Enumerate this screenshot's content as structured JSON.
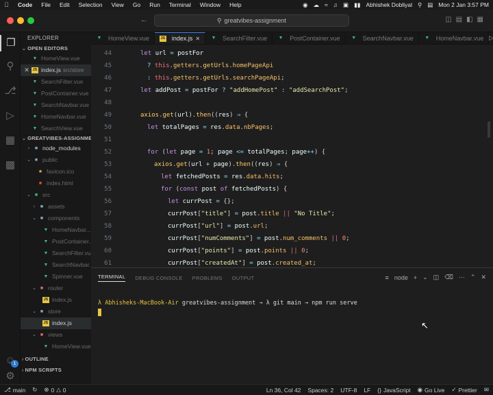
{
  "menubar": {
    "items": [
      "Code",
      "File",
      "Edit",
      "Selection",
      "View",
      "Go",
      "Run",
      "Terminal",
      "Window",
      "Help"
    ],
    "user": "Abhishek Dobliyal",
    "datetime": "Mon 2 Jan  3:57 PM"
  },
  "titlebar": {
    "search_text": "greatvibes-assignment"
  },
  "activity": {
    "badge": "1"
  },
  "sidebar": {
    "title": "EXPLORER",
    "open_editors_header": "OPEN EDITORS",
    "open_editors": [
      {
        "name": "HomeView.vue",
        "type": "vue"
      },
      {
        "name": "index.js",
        "type": "js",
        "sub": "src/store",
        "active": true
      },
      {
        "name": "SearchFilter.vue",
        "type": "vue"
      },
      {
        "name": "PostContainer.vue",
        "type": "vue"
      },
      {
        "name": "SearchNavbar.vue",
        "type": "vue"
      },
      {
        "name": "HomeNavbar.vue",
        "type": "vue"
      },
      {
        "name": "SearchView.vue",
        "type": "vue"
      }
    ],
    "project_header": "GREATVIBES-ASSIGNME...",
    "tree": {
      "node_modules": "node_modules",
      "public": "public",
      "favicon": "favicon.ico",
      "index_html": "index.html",
      "src": "src",
      "assets": "assets",
      "components": "components",
      "comp_files": [
        "HomeNavbar...",
        "PostContainer...",
        "SearchFilter.vue",
        "SearchNavbar...",
        "Spinner.vue"
      ],
      "router": "router",
      "router_index": "index.js",
      "store": "store",
      "store_index": "index.js",
      "views": "views",
      "views_home": "HomeView.vue"
    },
    "outline_header": "OUTLINE",
    "npm_header": "NPM SCRIPTS"
  },
  "tabs": [
    {
      "label": "HomeView.vue",
      "type": "vue"
    },
    {
      "label": "index.js",
      "type": "js",
      "active": true
    },
    {
      "label": "SearchFilter.vue",
      "type": "vue"
    },
    {
      "label": "PostContainer.vue",
      "type": "vue"
    },
    {
      "label": "SearchNavbar.vue",
      "type": "vue"
    },
    {
      "label": "HomeNavbar.vue",
      "type": "vue"
    }
  ],
  "editor": {
    "line_numbers": [
      "44",
      "45",
      "46",
      "47",
      "48",
      "49",
      "50",
      "51",
      "52",
      "53",
      "54",
      "55",
      "56",
      "57",
      "58",
      "59",
      "60",
      "61"
    ]
  },
  "panel": {
    "tabs": [
      "TERMINAL",
      "DEBUG CONSOLE",
      "PROBLEMS",
      "OUTPUT"
    ],
    "shell": "node",
    "prompt_host": "λ Abhisheks-MacBook-Air",
    "prompt_dir": "greatvibes-assignment",
    "prompt_cmd": "→ λ git main → npm run serve"
  },
  "status": {
    "branch": "main",
    "errors": "0",
    "warnings": "0",
    "position": "Ln 36, Col 42",
    "spaces": "Spaces: 2",
    "encoding": "UTF-8",
    "eol": "LF",
    "language": "JavaScript",
    "golive": "Go Live",
    "prettier": "Prettier"
  },
  "colors": {
    "accent": "#3b82f6",
    "close_red": "#ff5f57",
    "min_yellow": "#febc2e",
    "max_green": "#28c840"
  }
}
